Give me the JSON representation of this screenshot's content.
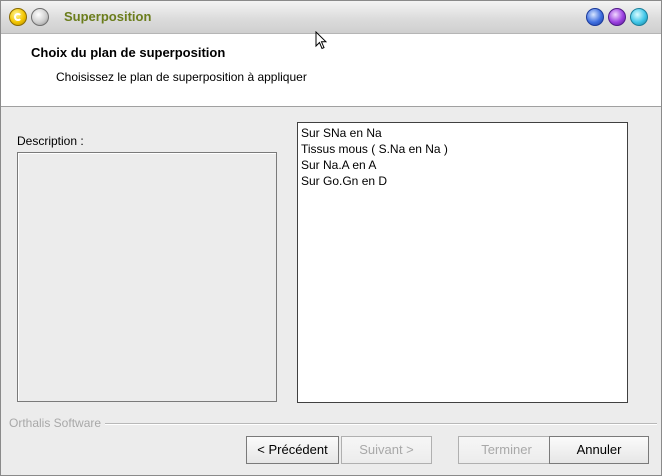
{
  "window": {
    "title": "Superposition"
  },
  "header": {
    "title": "Choix du plan de superposition",
    "subtitle": "Choisissez le plan de superposition à appliquer"
  },
  "description": {
    "label": "Description :",
    "text": ""
  },
  "plans": {
    "items": [
      "Sur SNa en Na",
      "Tissus mous ( S.Na en Na )",
      "Sur Na.A en A",
      "Sur Go.Gn en D"
    ]
  },
  "footer": {
    "vendor": "Orthalis Software",
    "buttons": {
      "previous": "< Précédent",
      "next": "Suivant >",
      "finish": "Terminer",
      "cancel": "Annuler"
    }
  },
  "icons": {
    "app": "app-logo-icon",
    "grey": "window-menu-icon",
    "blue": "minimize-icon",
    "purple": "maximize-icon",
    "cyan": "close-icon",
    "cursor": "mouse-pointer-icon"
  },
  "colors": {
    "title_text": "#6b7d1c",
    "window_bg": "#ececec",
    "disabled_text": "#a8a8a8"
  }
}
